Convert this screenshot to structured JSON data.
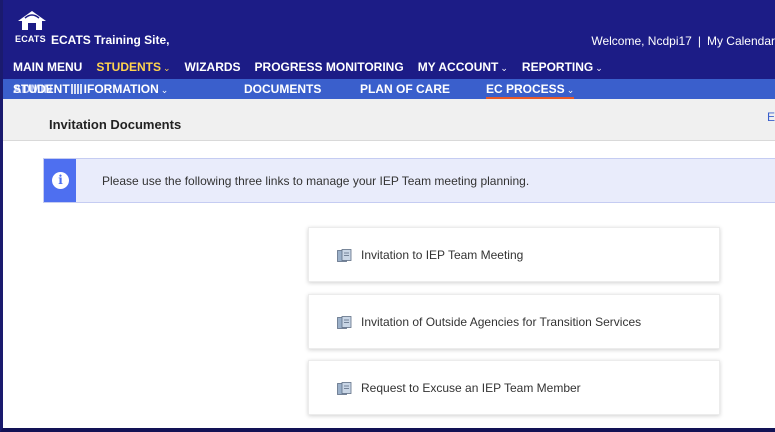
{
  "header": {
    "logo_text": "ECATS",
    "site_name": "ECATS Training Site,",
    "welcome_text": "Welcome, Ncdpi17",
    "separator": "|",
    "calendar_link": "My Calendar"
  },
  "main_nav": {
    "items": [
      {
        "label": "MAIN MENU",
        "has_dropdown": false,
        "active": false
      },
      {
        "label": "STUDENTS",
        "has_dropdown": true,
        "active": true
      },
      {
        "label": "WIZARDS",
        "has_dropdown": false,
        "active": false
      },
      {
        "label": "PROGRESS MONITORING",
        "has_dropdown": false,
        "active": false
      },
      {
        "label": "MY ACCOUNT",
        "has_dropdown": true,
        "active": false
      },
      {
        "label": "REPORTING",
        "has_dropdown": true,
        "active": false
      }
    ],
    "chevron": "⌄"
  },
  "sub_nav": {
    "admin_label": "ADMIN",
    "student_info_label_a": "STUDENT",
    "student_info_label_b": "IFORMATION",
    "documents_label": "DOCUMENTS",
    "plan_of_care_label": "PLAN OF CARE",
    "ec_process_label": "EC PROCESS"
  },
  "page": {
    "title": "Invitation Documents",
    "right_link": "E"
  },
  "alert": {
    "icon": "info-icon",
    "icon_glyph": "i",
    "message": "Please use the following three links to manage your IEP Team meeting planning."
  },
  "cards": [
    {
      "label": "Invitation to IEP Team Meeting",
      "icon": "documents-icon"
    },
    {
      "label": "Invitation of Outside Agencies for Transition Services",
      "icon": "documents-icon"
    },
    {
      "label": "Request to Excuse an IEP Team Member",
      "icon": "documents-icon"
    }
  ],
  "colors": {
    "topbar": "#1c1c86",
    "subnav": "#3a5fcc",
    "active_text": "#ffd34d",
    "active_underline": "#e85a2a",
    "alert_accent": "#4e6ff0"
  }
}
